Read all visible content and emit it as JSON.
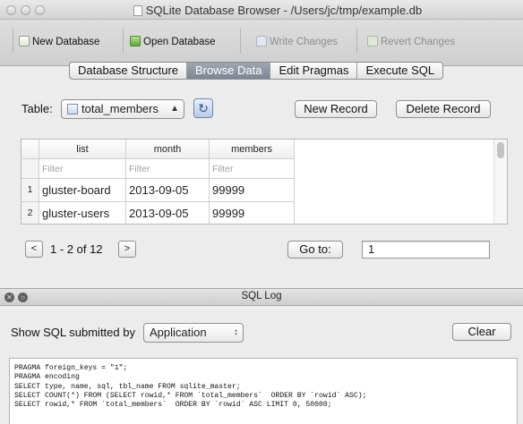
{
  "window": {
    "title": "SQLite Database Browser - /Users/jc/tmp/example.db"
  },
  "toolbar": {
    "new_database": "New Database",
    "open_database": "Open Database",
    "write_changes": "Write Changes",
    "revert_changes": "Revert Changes"
  },
  "tabs": [
    {
      "label": "Database Structure",
      "active": false
    },
    {
      "label": "Browse Data",
      "active": true
    },
    {
      "label": "Edit Pragmas",
      "active": false
    },
    {
      "label": "Execute SQL",
      "active": false
    }
  ],
  "browse": {
    "table_label": "Table:",
    "table_selected": "total_members",
    "new_record": "New Record",
    "delete_record": "Delete Record",
    "columns": [
      "list",
      "month",
      "members"
    ],
    "filter_placeholder": "Filter",
    "rows": [
      {
        "index": "1",
        "cells": [
          "gluster-board",
          "2013-09-05",
          "99999"
        ]
      },
      {
        "index": "2",
        "cells": [
          "gluster-users",
          "2013-09-05",
          "99999"
        ]
      }
    ],
    "prev_label": "<",
    "next_label": ">",
    "page_status": "1 - 2 of 12",
    "goto_label": "Go to:",
    "goto_value": "1"
  },
  "sql_log": {
    "title": "SQL Log",
    "submitted_by_label": "Show SQL submitted by",
    "submitted_by_value": "Application",
    "clear_label": "Clear",
    "lines": [
      "PRAGMA foreign_keys = \"1\";",
      "PRAGMA encoding",
      "SELECT type, name, sql, tbl_name FROM sqlite_master;",
      "SELECT COUNT(*) FROM (SELECT rowid,* FROM `total_members`  ORDER BY `rowid` ASC);",
      "SELECT rowid,* FROM `total_members`  ORDER BY `rowid` ASC LIMIT 0, 50000;"
    ]
  },
  "colors": {
    "active_tab": "#8a93a0",
    "window_bg": "#ececec"
  }
}
